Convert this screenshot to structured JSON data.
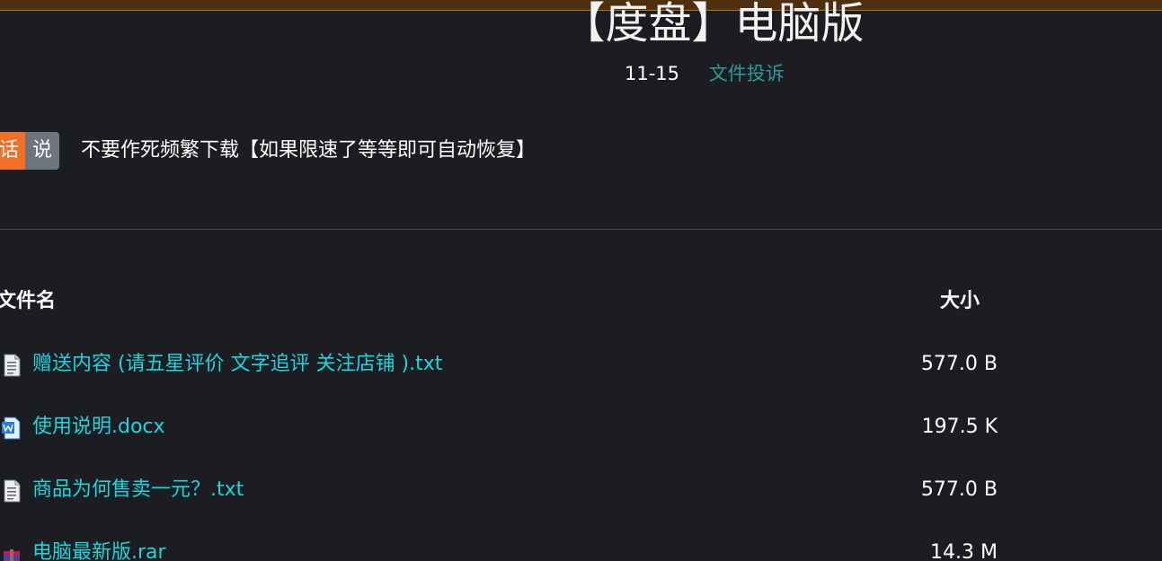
{
  "header": {
    "title": "【度盘】电脑版",
    "date": "11-15",
    "report_link": "文件投诉"
  },
  "notice": {
    "tag_left": "话",
    "tag_right": "说",
    "text": "不要作死频繁下载【如果限速了等等即可自动恢复】"
  },
  "table": {
    "col_name": "文件名",
    "col_size": "大小",
    "rows": [
      {
        "icon": "text-file-icon",
        "name": "赠送内容 (请五星评价 文字追评 关注店铺 ).txt",
        "size": "577.0 B"
      },
      {
        "icon": "word-doc-icon",
        "name": "使用说明.docx",
        "size": "197.5 K"
      },
      {
        "icon": "text-file-icon",
        "name": "商品为何售卖一元？.txt",
        "size": "577.0 B"
      },
      {
        "icon": "archive-rar-icon",
        "name": "电脑最新版.rar",
        "size": "14.3 M"
      }
    ]
  },
  "colors": {
    "background": "#1b1d20",
    "link": "#19d6e0",
    "report_link": "#2a9c9a",
    "tag_orange": "#f36f24",
    "tag_gray": "#6c757d",
    "top_strip": "#4e3011"
  }
}
